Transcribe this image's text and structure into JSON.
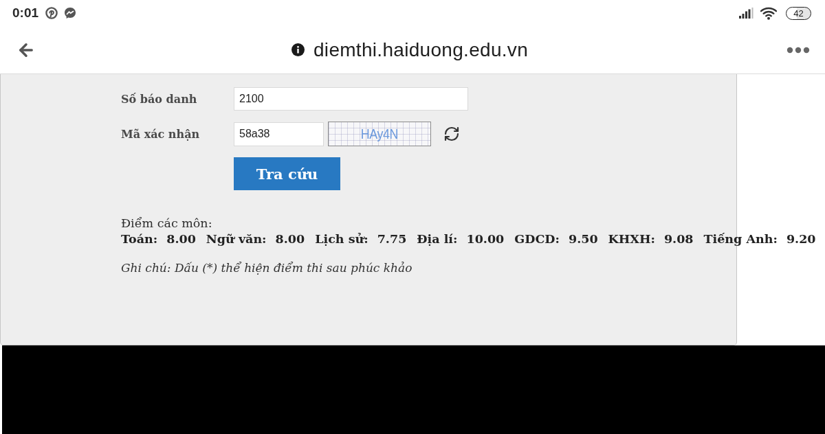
{
  "status_bar": {
    "time": "0:01",
    "battery": "42"
  },
  "browser_bar": {
    "url": "diemthi.haiduong.edu.vn"
  },
  "form": {
    "fields": [
      {
        "kind": "text",
        "label": "Số báo danh",
        "value": "2100"
      },
      {
        "kind": "captcha",
        "label": "Mã xác nhận",
        "value": "58a38",
        "captcha": "HAy4N"
      }
    ],
    "submit": "Tra cứu"
  },
  "results": {
    "heading": "Điểm các môn:",
    "scores": [
      {
        "subject": "Toán:",
        "score": "8.00"
      },
      {
        "subject": "Ngữ văn:",
        "score": "8.00"
      },
      {
        "subject": "Lịch sử:",
        "score": "7.75"
      },
      {
        "subject": "Địa lí:",
        "score": "10.00"
      },
      {
        "subject": "GDCD:",
        "score": "9.50"
      },
      {
        "subject": "KHXH:",
        "score": "9.08"
      },
      {
        "subject": "Tiếng Anh:",
        "score": "9.20"
      }
    ],
    "note": "Ghi chú: Dấu (*) thể hiện điểm thi sau phúc khảo"
  }
}
